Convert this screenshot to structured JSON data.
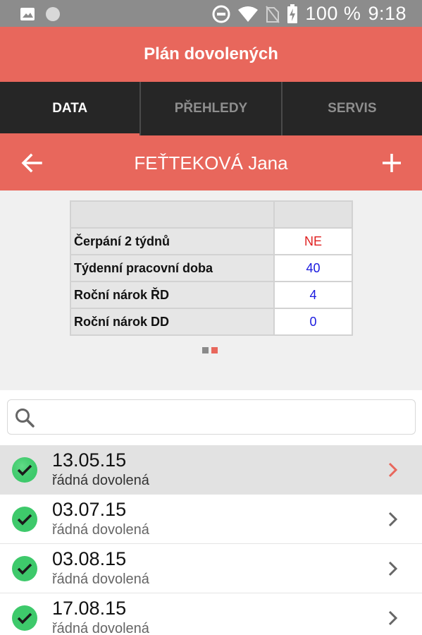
{
  "status_bar": {
    "battery": "100 %",
    "time": "9:18",
    "icons": [
      "image-icon",
      "circle-notification-icon",
      "do-not-disturb-icon",
      "wifi-icon",
      "no-sim-icon",
      "battery-charging-icon"
    ]
  },
  "app": {
    "title": "Plán dovolených"
  },
  "tabs": [
    {
      "label": "DATA",
      "active": true
    },
    {
      "label": "PŘEHLEDY",
      "active": false
    },
    {
      "label": "SERVIS",
      "active": false
    }
  ],
  "person": {
    "name": "FEŤTEKOVÁ Jana"
  },
  "info_table": {
    "rows": [
      {
        "label": "Čerpání 2 týdnů",
        "value": "NE"
      },
      {
        "label": "Týdenní pracovní doba",
        "value": "40"
      },
      {
        "label": "Roční nárok ŘD",
        "value": "4"
      },
      {
        "label": "Roční nárok DD",
        "value": "0"
      }
    ]
  },
  "pager": {
    "pages": 2,
    "current": 2
  },
  "search": {
    "placeholder": "",
    "value": ""
  },
  "list": [
    {
      "date": "13.05.15",
      "type": "řádná dovolená",
      "selected": true
    },
    {
      "date": "03.07.15",
      "type": "řádná dovolená",
      "selected": false
    },
    {
      "date": "03.08.15",
      "type": "řádná dovolená",
      "selected": false
    },
    {
      "date": "17.08.15",
      "type": "řádná dovolená",
      "selected": false
    }
  ],
  "colors": {
    "accent": "#e8675c",
    "tab_bar": "#262626",
    "check_green": "#3ec96b",
    "value_blue": "#1a1adf",
    "value_red": "#e02020"
  }
}
